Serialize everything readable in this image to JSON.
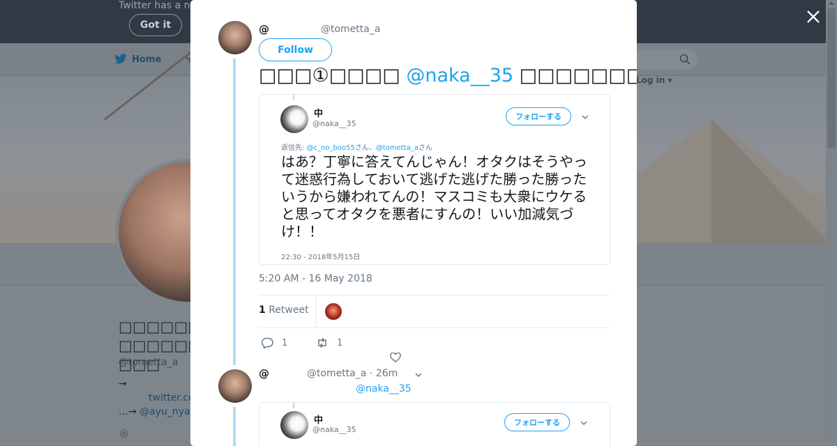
{
  "background": {
    "cookie_text": "Twitter has a n",
    "got_it_label": "Got it",
    "nav_home_label": "Home",
    "login_label": "Log in ▾",
    "profile_name": "□□□□□□□□□□□□□□□",
    "profile_handle": "@tometta_a",
    "bio_arrow": "→",
    "bio_link": "twitter.co",
    "bio_link2_prefix": "…→ ",
    "bio_link2": "@ayu_nya",
    "location_icon": "◎"
  },
  "modal": {
    "tweet": {
      "at_label": "@",
      "handle": "@tometta_a",
      "follow_label": "Follow",
      "text_prefix": "□□□①□□□□ ",
      "text_mention": "@naka__35",
      "text_suffix": " □□□□□□□□□□□□□□□□□□□□□□□□□□□□□□□",
      "timestamp": "5:20 AM - 16 May 2018",
      "retweet_count": "1",
      "retweet_label": " Retweet",
      "reply_count": "1",
      "retweet_action_count": "1"
    },
    "embed1": {
      "name": "中",
      "handle": "@naka__35",
      "follow_label": "フォローする",
      "reply_to_prefix": "返信先: ",
      "reply_to_user1": "@c_no_boo55",
      "reply_to_mid": "さん、",
      "reply_to_user2": "@tometta_a",
      "reply_to_suffix": "さん",
      "body": "はあ？丁寧に答えてんじゃん！オタクはそうやって迷惑行為しておいて逃げた逃げた勝った勝ったいうから嫌われてんの！マスコミも大衆にウケると思ってオタクを悪者にすんの！いい加減気づけ！！",
      "time": "22:30 - 2018年5月15日"
    },
    "reply": {
      "at_label": "@",
      "handle": "@tometta_a",
      "time": " · 26m",
      "replying_to": "@naka__35"
    },
    "embed2": {
      "name": "中",
      "handle": "@naka__35",
      "follow_label": "フォローする"
    }
  },
  "colors": {
    "accent": "#1da1f2",
    "thread_line": "#b3daf4",
    "overlay": "#7e868c"
  }
}
